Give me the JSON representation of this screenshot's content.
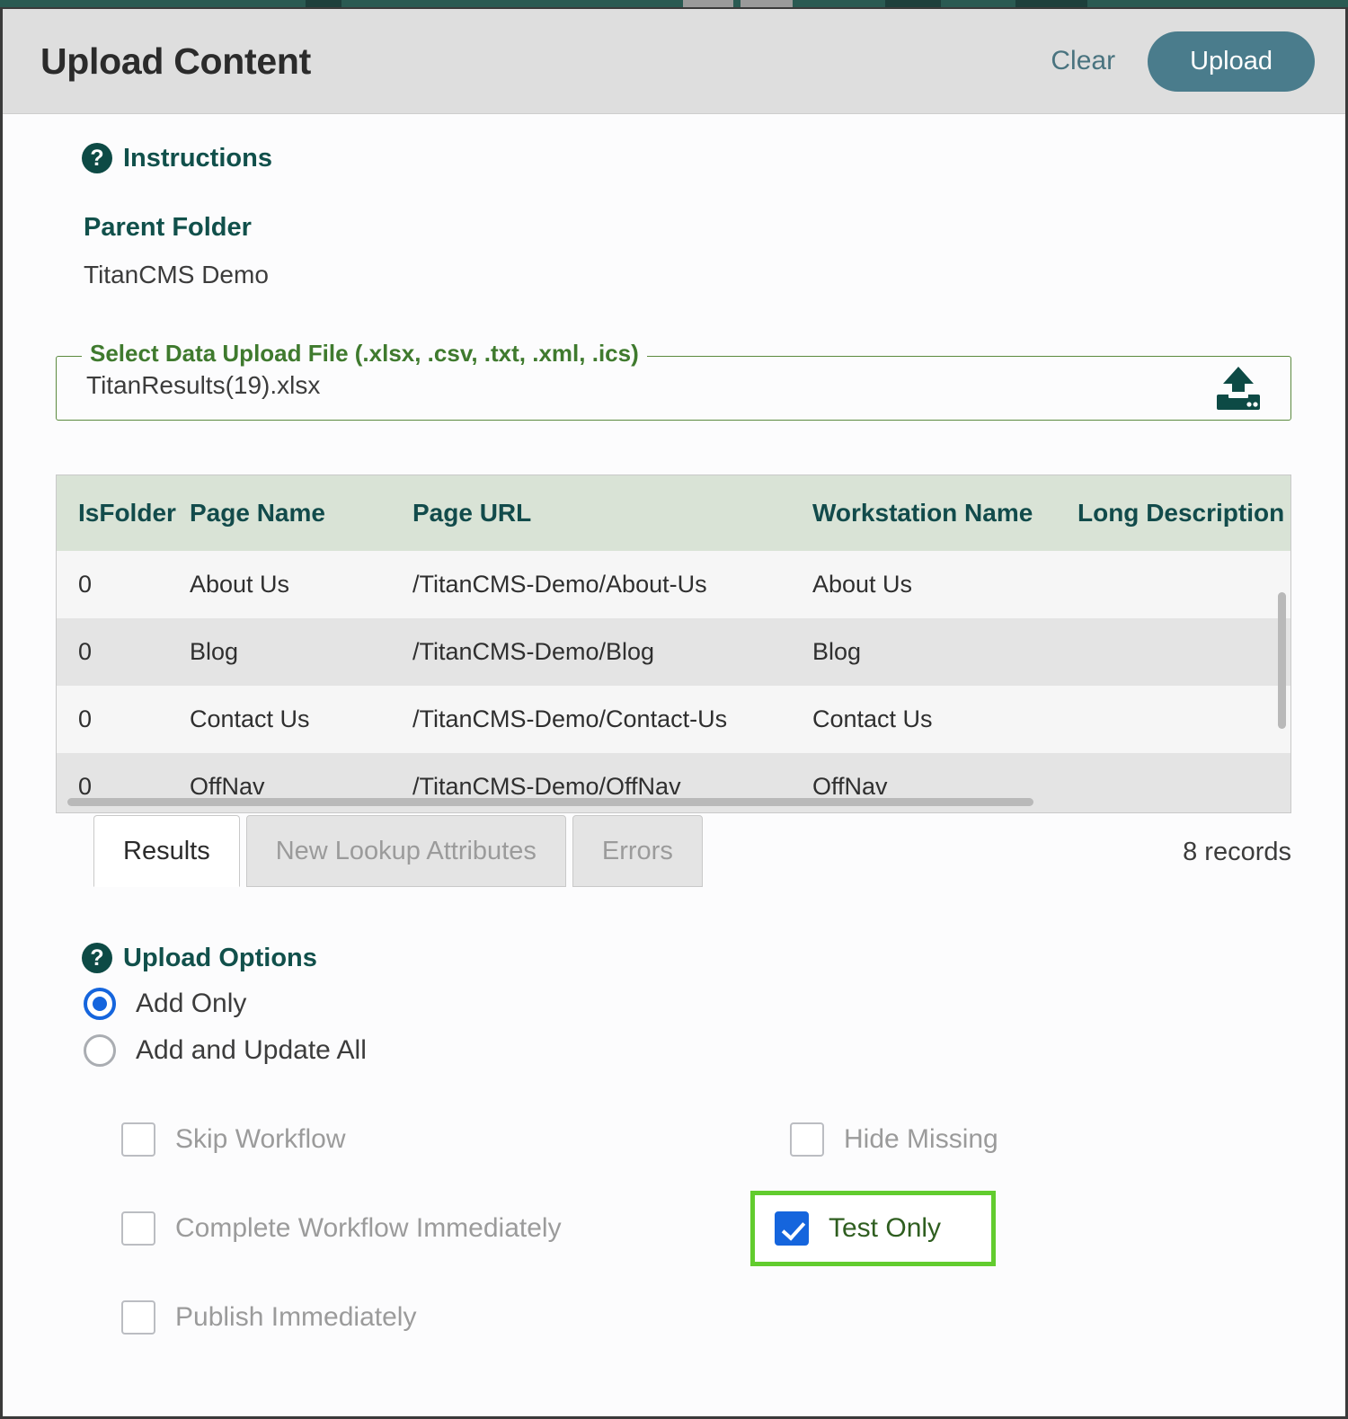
{
  "header": {
    "title": "Upload Content",
    "clear_label": "Clear",
    "upload_label": "Upload"
  },
  "instructions": {
    "icon": "help-circle-icon",
    "title": "Instructions",
    "parent_folder_label": "Parent Folder",
    "parent_folder_value": "TitanCMS Demo"
  },
  "file_field": {
    "legend": "Select Data Upload File (.xlsx, .csv, .txt, .xml, .ics)",
    "value": "TitanResults(19).xlsx",
    "icon": "upload-icon"
  },
  "table": {
    "columns": [
      "IsFolder",
      "Page Name",
      "Page URL",
      "Workstation Name",
      "Long Description"
    ],
    "rows": [
      {
        "isfolder": "0",
        "page_name": "About Us",
        "page_url": "/TitanCMS-Demo/About-Us",
        "workstation_name": "About Us",
        "long_description": ""
      },
      {
        "isfolder": "0",
        "page_name": "Blog",
        "page_url": "/TitanCMS-Demo/Blog",
        "workstation_name": "Blog",
        "long_description": ""
      },
      {
        "isfolder": "0",
        "page_name": "Contact Us",
        "page_url": "/TitanCMS-Demo/Contact-Us",
        "workstation_name": "Contact Us",
        "long_description": ""
      },
      {
        "isfolder": "0",
        "page_name": "OffNav",
        "page_url": "/TitanCMS-Demo/OffNav",
        "workstation_name": "OffNav",
        "long_description": ""
      }
    ]
  },
  "tabs": {
    "items": [
      {
        "label": "Results",
        "state": "active"
      },
      {
        "label": "New Lookup Attributes",
        "state": "disabled"
      },
      {
        "label": "Errors",
        "state": "disabled"
      }
    ],
    "records_count": "8  records"
  },
  "upload_options": {
    "icon": "help-circle-icon",
    "title": "Upload Options",
    "radios": [
      {
        "label": "Add Only",
        "checked": true
      },
      {
        "label": "Add and Update All",
        "checked": false
      }
    ],
    "checkboxes_left": [
      {
        "label": "Skip Workflow",
        "checked": false,
        "disabled": true
      },
      {
        "label": "Complete Workflow Immediately",
        "checked": false,
        "disabled": true
      },
      {
        "label": "Publish Immediately",
        "checked": false,
        "disabled": true
      }
    ],
    "checkboxes_right": [
      {
        "label": "Hide Missing",
        "checked": false,
        "disabled": true
      },
      {
        "label": "Test Only",
        "checked": true,
        "disabled": false,
        "highlighted": true
      }
    ]
  },
  "colors": {
    "header_bg": "#dedede",
    "upload_button": "#4a7c8c",
    "accent_teal": "#11504b",
    "legend_green": "#3f7a2e",
    "table_header_bg": "#d9e3d6",
    "checkbox_blue": "#1565dd",
    "highlight_green": "#62cc2e",
    "background_app": "#2a5a52"
  }
}
